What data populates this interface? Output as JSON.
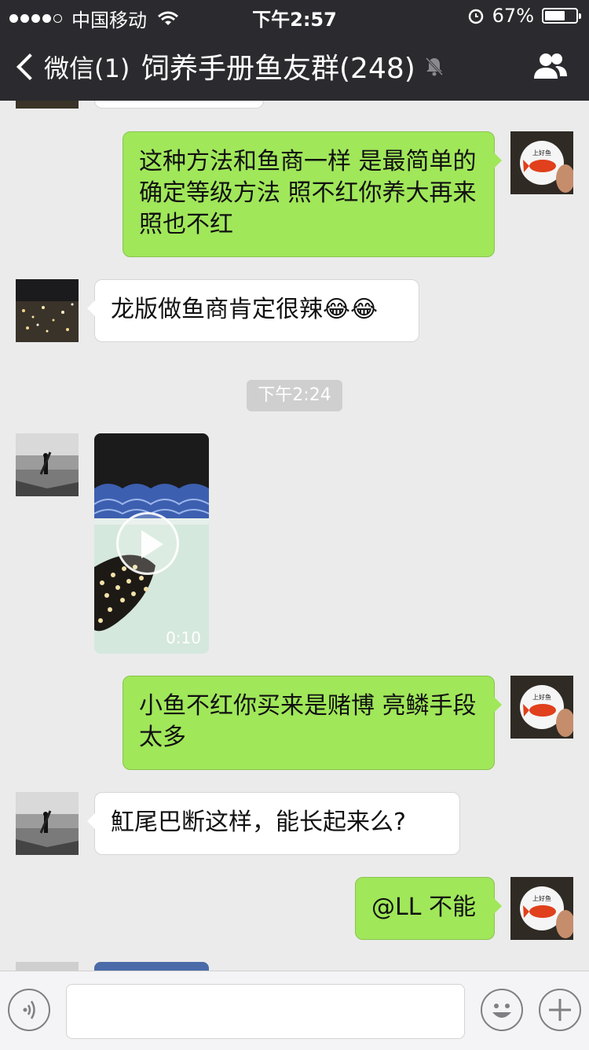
{
  "status_bar": {
    "carrier": "中国移动",
    "time": "下午2:57",
    "battery": "67%",
    "battery_level": 0.67
  },
  "nav": {
    "back_label": "微信(1)",
    "title": "饲养手册鱼友群(248)"
  },
  "messages": [
    {
      "side": "right",
      "text": "这种方法和鱼商一样 是最简单的确定等级方法 照不红你养大再来照也不红"
    },
    {
      "side": "left",
      "text": "龙版做鱼商肯定很辣😂😂"
    },
    {
      "side": "left",
      "type": "video",
      "duration": "0:10"
    },
    {
      "side": "right",
      "text": "小鱼不红你买来是赌博 亮鳞手段太多"
    },
    {
      "side": "left",
      "text": "魟尾巴断这样，能长起来么?"
    },
    {
      "side": "right",
      "text": "@LL 不能"
    }
  ],
  "timestamp": "下午2:24",
  "input_bar": {
    "placeholder": ""
  },
  "colors": {
    "bar_bg": "#2b2b2f",
    "chat_bg": "#ebebeb",
    "green_bubble": "#a0e75a"
  }
}
